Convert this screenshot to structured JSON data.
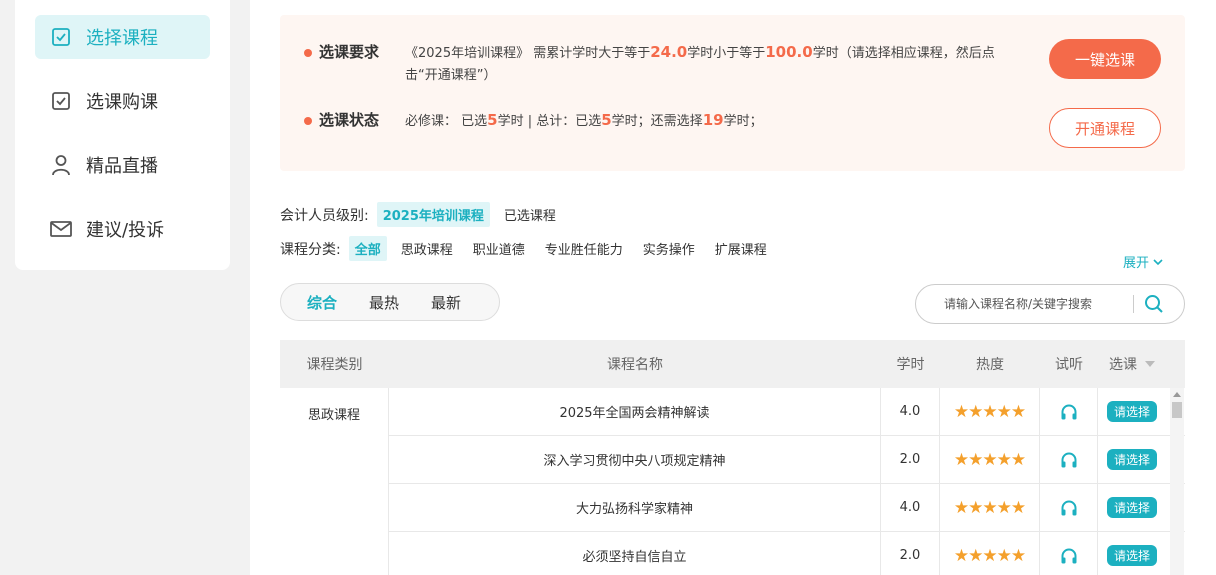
{
  "sidebar": {
    "items": [
      {
        "label": "选择课程",
        "icon": "checkbox-icon",
        "active": true
      },
      {
        "label": "选课购课",
        "icon": "checkbox-icon",
        "active": false
      },
      {
        "label": "精品直播",
        "icon": "user-icon",
        "active": false
      },
      {
        "label": "建议/投诉",
        "icon": "mail-icon",
        "active": false
      }
    ]
  },
  "notice": {
    "requirement": {
      "title": "选课要求",
      "prefix": "《2025年培训课程》 需累计学时大于等于",
      "min": "24.0",
      "mid": "学时小于等于",
      "max": "100.0",
      "suffix": "学时（请选择相应课程，然后点击“开通课程”）"
    },
    "status": {
      "title": "选课状态",
      "part1": "必修课： 已选",
      "required_selected": "5",
      "part2": "学时 | 总计：已选",
      "total_selected": "5",
      "part3": "学时；还需选择",
      "remaining": "19",
      "part4": "学时；"
    },
    "one_click_label": "一键选课",
    "open_label": "开通课程"
  },
  "filters": {
    "level_label": "会计人员级别:",
    "level_options": [
      {
        "label": "2025年培训课程",
        "active": true
      },
      {
        "label": "已选课程",
        "active": false
      }
    ],
    "category_label": "课程分类:",
    "category_options": [
      {
        "label": "全部",
        "active": true
      },
      {
        "label": "思政课程",
        "active": false
      },
      {
        "label": "职业道德",
        "active": false
      },
      {
        "label": "专业胜任能力",
        "active": false
      },
      {
        "label": "实务操作",
        "active": false
      },
      {
        "label": "扩展课程",
        "active": false
      }
    ],
    "expand_label": "展开"
  },
  "sort": {
    "tabs": [
      {
        "label": "综合",
        "active": true
      },
      {
        "label": "最热",
        "active": false
      },
      {
        "label": "最新",
        "active": false
      }
    ]
  },
  "search": {
    "placeholder": "请输入课程名称/关键字搜索",
    "value": ""
  },
  "table": {
    "headers": [
      "课程类别",
      "课程名称",
      "学时",
      "热度",
      "试听",
      "选课"
    ],
    "category": "思政课程",
    "rows": [
      {
        "name": "2025年全国两会精神解读",
        "hours": "4.0",
        "stars": "★★★★★",
        "action": "请选择"
      },
      {
        "name": "深入学习贯彻中央八项规定精神",
        "hours": "2.0",
        "stars": "★★★★★",
        "action": "请选择"
      },
      {
        "name": "大力弘扬科学家精神",
        "hours": "4.0",
        "stars": "★★★★★",
        "action": "请选择"
      },
      {
        "name": "必须坚持自信自立",
        "hours": "2.0",
        "stars": "★★★★★",
        "action": "请选择"
      }
    ]
  },
  "colors": {
    "accent": "#1cb0c0",
    "highlight": "#f46a4a",
    "star": "#f4a02c"
  }
}
